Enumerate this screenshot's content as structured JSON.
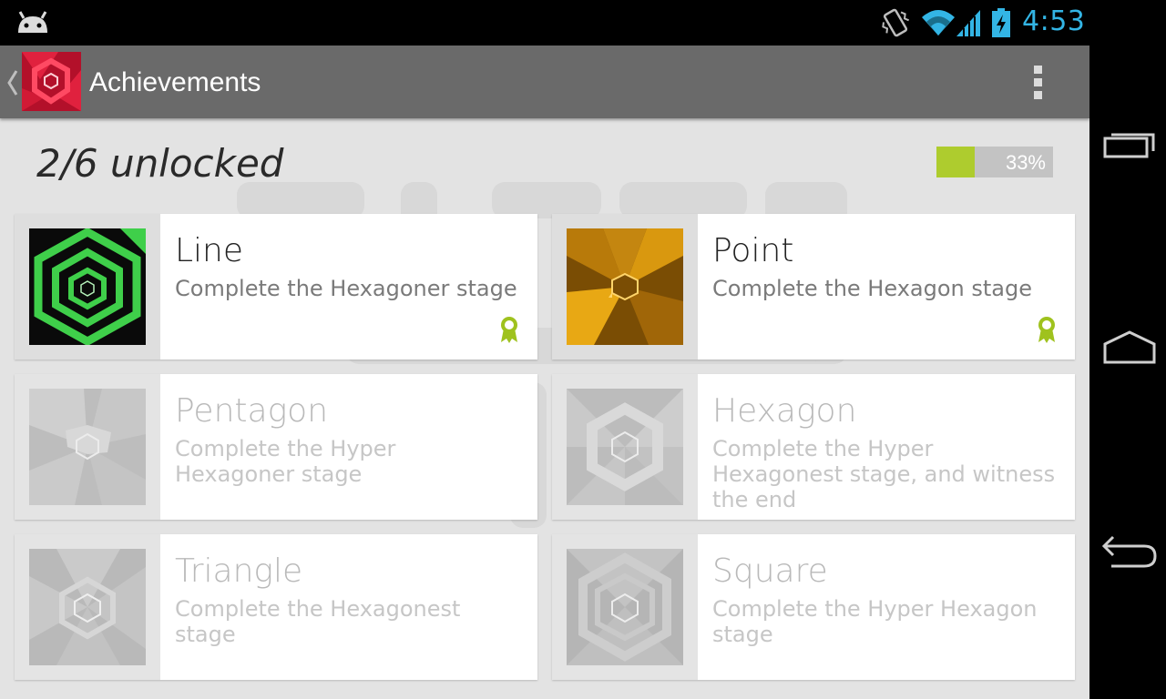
{
  "status_bar": {
    "time": "4:53",
    "icons": [
      "android-notification-icon",
      "vibrate-icon",
      "wifi-icon",
      "signal-icon",
      "battery-charging-icon"
    ]
  },
  "action_bar": {
    "title": "Achievements",
    "icons": [
      "up-caret-icon",
      "app-hexagon-icon",
      "overflow-menu-icon"
    ]
  },
  "summary": {
    "unlocked_text": "2/6 unlocked",
    "progress_label": "33%",
    "progress_fraction": 0.33
  },
  "achievements": [
    {
      "title": "Line",
      "description": "Complete the Hexagoner stage",
      "unlocked": true
    },
    {
      "title": "Point",
      "description": "Complete the Hexagon stage",
      "unlocked": true
    },
    {
      "title": "Pentagon",
      "description": "Complete the Hyper Hexagoner stage",
      "unlocked": false
    },
    {
      "title": "Hexagon",
      "description": "Complete the Hyper Hexagonest stage, and witness the end",
      "unlocked": false
    },
    {
      "title": "Triangle",
      "description": "Complete the Hexagonest stage",
      "unlocked": false
    },
    {
      "title": "Square",
      "description": "Complete the Hyper Hexagon stage",
      "unlocked": false
    }
  ],
  "colors": {
    "action_bar": "#6a6a6a",
    "progress": "#aecc2e",
    "clock": "#33b5e5",
    "award": "#9fc21e"
  },
  "nav_bar": {
    "icons": [
      "recents-icon",
      "home-icon",
      "back-icon"
    ]
  }
}
